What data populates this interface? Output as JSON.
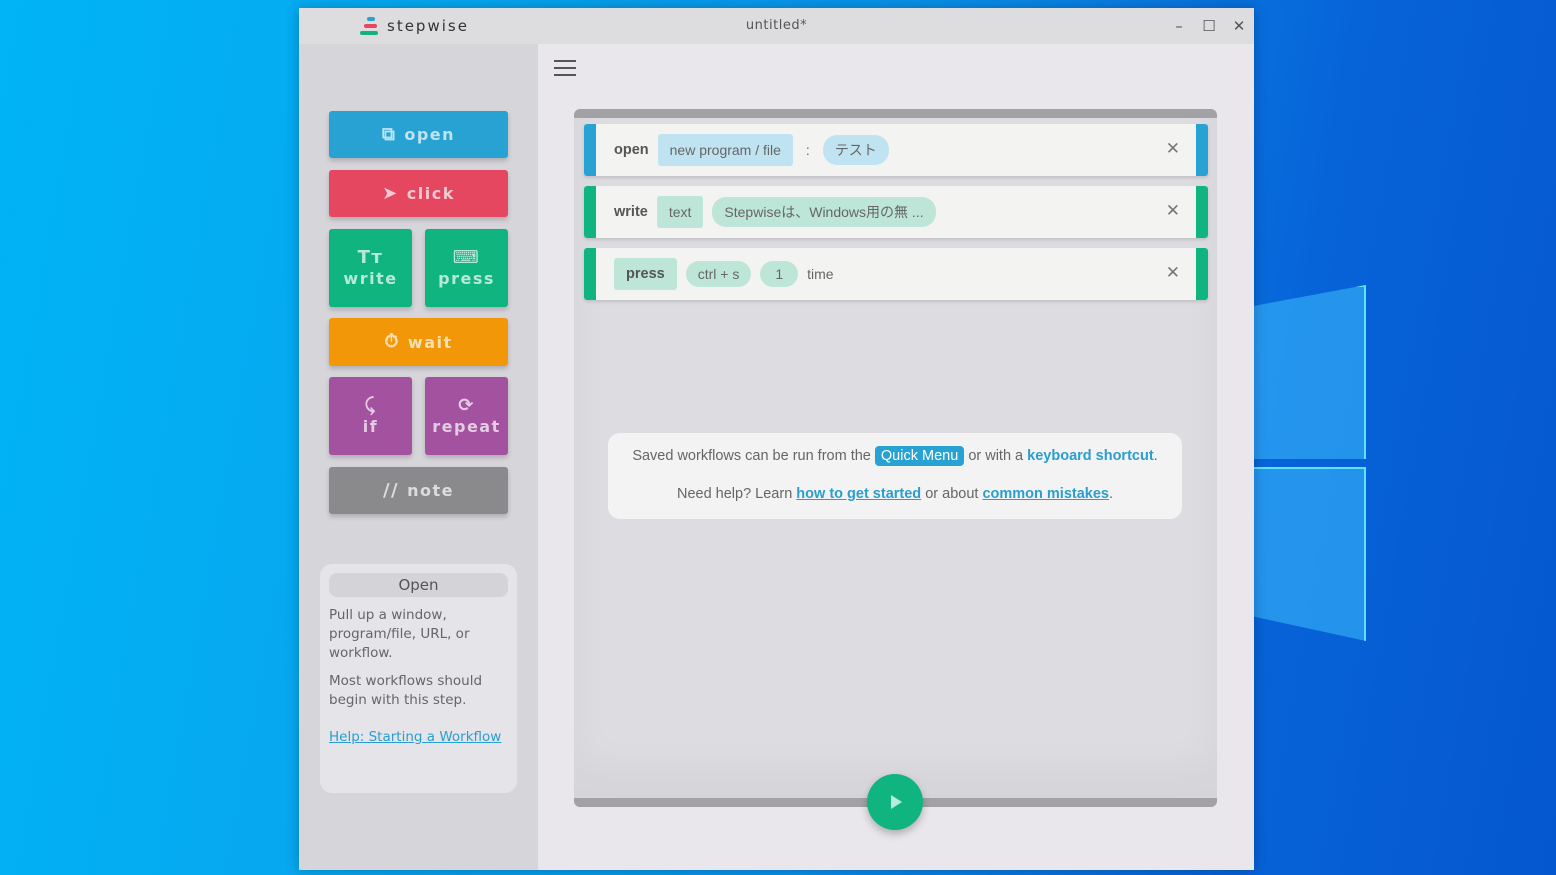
{
  "app": {
    "brand_name": "stepwise",
    "document_title": "untitled*",
    "window_controls": {
      "minimize": "–",
      "maximize": "☐",
      "close": "✕"
    }
  },
  "colors": {
    "open": "#27a2d2",
    "click": "#e4475f",
    "write": "#10b47f",
    "press": "#10b47f",
    "wait": "#f29708",
    "logic": "#a2529f",
    "note": "#8a8a8c"
  },
  "sidebar": {
    "steps": [
      {
        "id": "open",
        "label": "open",
        "icon": "window-open-icon"
      },
      {
        "id": "click",
        "label": "click",
        "icon": "cursor-arrow-icon"
      },
      {
        "id": "write",
        "label": "write",
        "icon": "text-icon"
      },
      {
        "id": "press",
        "label": "press",
        "icon": "keyboard-icon"
      },
      {
        "id": "wait",
        "label": "wait",
        "icon": "stopwatch-icon"
      },
      {
        "id": "if",
        "label": "if",
        "icon": "branch-icon"
      },
      {
        "id": "repeat",
        "label": "repeat",
        "icon": "loop-icon"
      },
      {
        "id": "note",
        "label": "note",
        "icon": "comment-slashes-icon",
        "prefix": "//"
      }
    ],
    "info": {
      "title": "Open",
      "paragraph1": "Pull up a window, program/file, URL, or workflow.",
      "paragraph2": "Most workflows should begin with this step.",
      "help_link": "Help: Starting a Workflow"
    }
  },
  "workflow": {
    "steps": [
      {
        "keyword": "open",
        "type_chip": "new program / file",
        "separator": ":",
        "value": "テスト"
      },
      {
        "keyword": "write",
        "type_chip": "text",
        "value": "Stepwiseは、Windows用の無 ..."
      },
      {
        "keyword": "press",
        "keys": "ctrl + s",
        "count": "1",
        "unit": "time"
      }
    ],
    "close_glyph": "✕"
  },
  "help": {
    "line1_pre": "Saved workflows can be run from the",
    "quick_menu": "Quick Menu",
    "line1_mid": "or with a",
    "keyboard_shortcut": "keyboard shortcut",
    "line1_end": ".",
    "line2_pre": "Need help? Learn",
    "get_started": "how to get started",
    "line2_mid": "or about",
    "common_mistakes": "common mistakes",
    "line2_end": "."
  }
}
